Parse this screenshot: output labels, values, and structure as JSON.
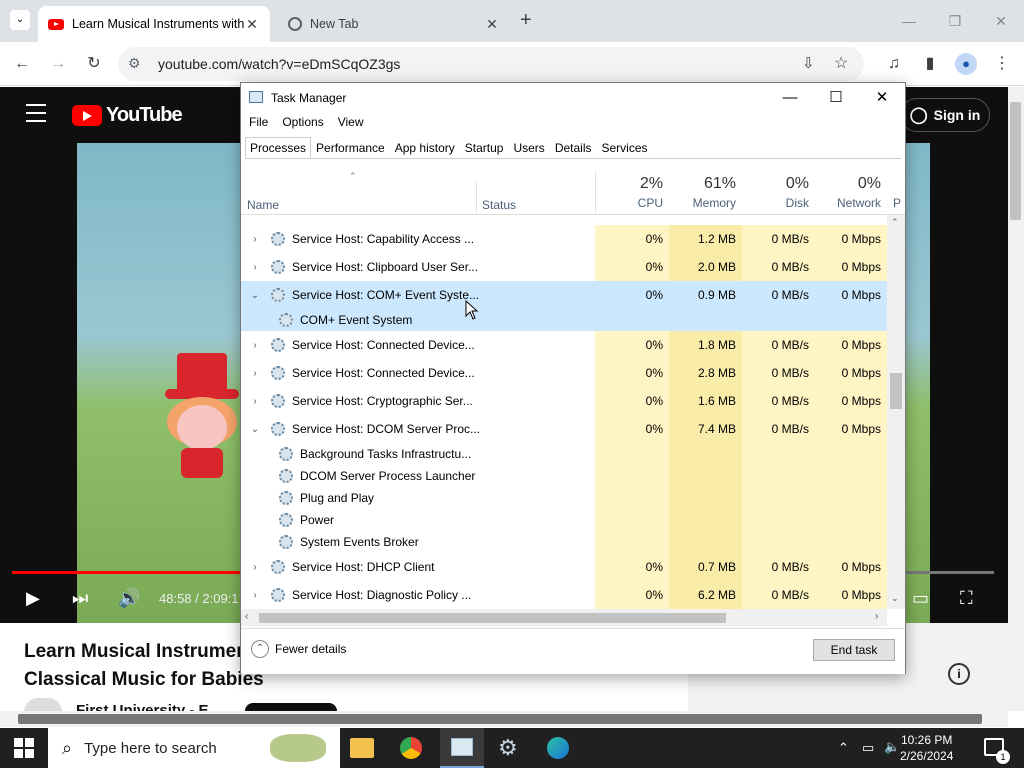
{
  "browser": {
    "tabs": [
      {
        "title": "Learn Musical Instruments with"
      },
      {
        "title": "New Tab"
      }
    ],
    "url": "youtube.com/watch?v=eDmSCqOZ3gs"
  },
  "youtube": {
    "logo_text": "YouTube",
    "sign_in": "Sign in",
    "time": "48:58 / 2:09:1",
    "progress_fraction": 0.235,
    "video_title_line1": "Learn Musical Instrumer",
    "video_title_line2": "Classical Music for Babies",
    "channel": "First University - E"
  },
  "task_manager": {
    "title": "Task Manager",
    "menu": [
      "File",
      "Options",
      "View"
    ],
    "tabs": [
      "Processes",
      "Performance",
      "App history",
      "Startup",
      "Users",
      "Details",
      "Services"
    ],
    "active_tab": "Processes",
    "headers": {
      "name": "Name",
      "status": "Status",
      "cpu_pct": "2%",
      "cpu": "CPU",
      "mem_pct": "61%",
      "mem": "Memory",
      "disk_pct": "0%",
      "disk": "Disk",
      "net_pct": "0%",
      "net": "Network",
      "extra": "P"
    },
    "rows": [
      {
        "name": "Service Host: Capability Access ...",
        "cpu": "0%",
        "mem": "1.2 MB",
        "disk": "0 MB/s",
        "net": "0 Mbps",
        "expanded": false
      },
      {
        "name": "Service Host: Clipboard User Ser...",
        "cpu": "0%",
        "mem": "2.0 MB",
        "disk": "0 MB/s",
        "net": "0 Mbps",
        "expanded": false
      },
      {
        "name": "Service Host: COM+ Event Syste...",
        "cpu": "0%",
        "mem": "0.9 MB",
        "disk": "0 MB/s",
        "net": "0 Mbps",
        "expanded": true,
        "selected": true
      },
      {
        "name": "COM+ Event System",
        "child": true,
        "selected": true
      },
      {
        "name": "Service Host: Connected Device...",
        "cpu": "0%",
        "mem": "1.8 MB",
        "disk": "0 MB/s",
        "net": "0 Mbps",
        "expanded": false
      },
      {
        "name": "Service Host: Connected Device...",
        "cpu": "0%",
        "mem": "2.8 MB",
        "disk": "0 MB/s",
        "net": "0 Mbps",
        "expanded": false
      },
      {
        "name": "Service Host: Cryptographic Ser...",
        "cpu": "0%",
        "mem": "1.6 MB",
        "disk": "0 MB/s",
        "net": "0 Mbps",
        "expanded": false
      },
      {
        "name": "Service Host: DCOM Server Proc...",
        "cpu": "0%",
        "mem": "7.4 MB",
        "disk": "0 MB/s",
        "net": "0 Mbps",
        "expanded": true
      },
      {
        "name": "Background Tasks Infrastructu...",
        "child": true
      },
      {
        "name": "DCOM Server Process Launcher",
        "child": true
      },
      {
        "name": "Plug and Play",
        "child": true
      },
      {
        "name": "Power",
        "child": true
      },
      {
        "name": "System Events Broker",
        "child": true
      },
      {
        "name": "Service Host: DHCP Client",
        "cpu": "0%",
        "mem": "0.7 MB",
        "disk": "0 MB/s",
        "net": "0 Mbps",
        "expanded": false
      },
      {
        "name": "Service Host: Diagnostic Policy ...",
        "cpu": "0%",
        "mem": "6.2 MB",
        "disk": "0 MB/s",
        "net": "0 Mbps",
        "expanded": false
      }
    ],
    "fewer_details": "Fewer details",
    "end_task": "End task"
  },
  "taskbar": {
    "search_placeholder": "Type here to search",
    "time": "10:26 PM",
    "date": "2/26/2024",
    "notification_count": "1"
  }
}
